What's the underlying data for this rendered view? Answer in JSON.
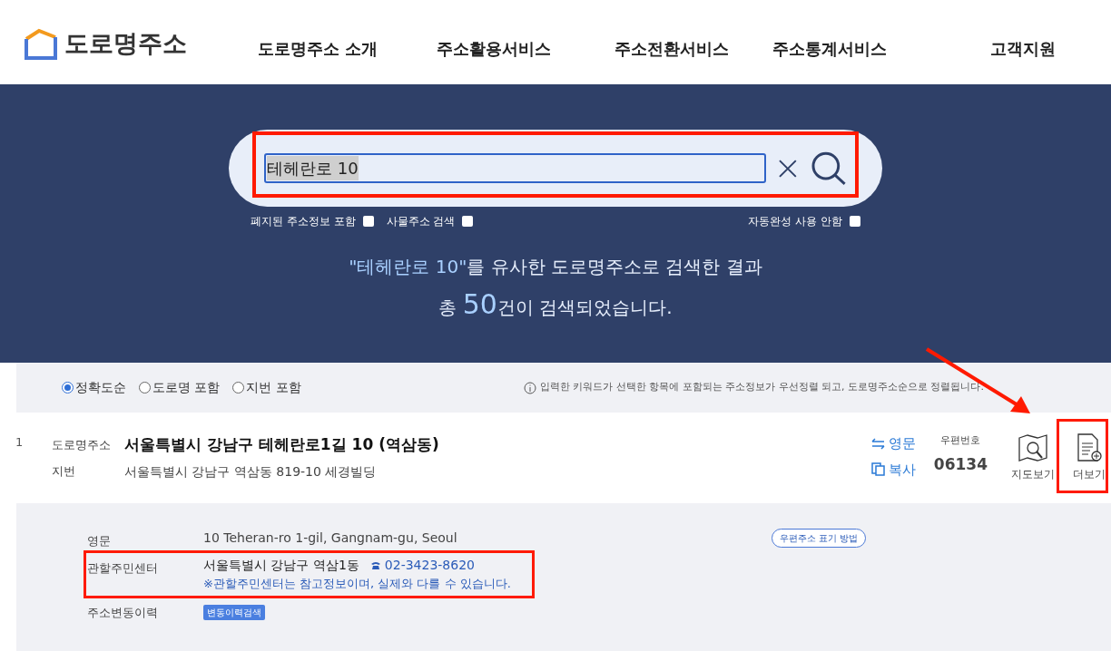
{
  "header": {
    "logo": "도로명주소",
    "nav": [
      "도로명주소 소개",
      "주소활용서비스",
      "주소전환서비스",
      "주소통계서비스",
      "고객지원"
    ]
  },
  "search": {
    "value": "테헤란로 10",
    "options": [
      {
        "label": "폐지된 주소정보 포함",
        "checked": false
      },
      {
        "label": "사물주소 검색",
        "checked": false
      },
      {
        "label": "자동완성 사용 안함",
        "checked": false
      }
    ]
  },
  "summary": {
    "line1_quote": "\"테헤란로 10\"",
    "line1_rest": "를 유사한 도로명주소로 검색한 결과",
    "line2_pre": "총",
    "count": "50",
    "line2_post": "건이 검색되었습니다."
  },
  "sort": [
    {
      "label": "정확도순",
      "selected": true
    },
    {
      "label": "도로명 포함",
      "selected": false
    },
    {
      "label": "지번 포함",
      "selected": false
    }
  ],
  "sort_note": "입력한 키워드가 선택한 항목에 포함되는 주소정보가 우선정렬 되고, 도로명주소순으로 정렬됩니다.",
  "result": {
    "index": "1",
    "road_label": "도로명주소",
    "road_address": "서울특별시 강남구 테헤란로1길 10 (역삼동)",
    "jibun_label": "지번",
    "jibun_address": "서울특별시 강남구 역삼동 819-10 세경빌딩",
    "english_link": "영문",
    "copy_link": "복사",
    "postal_label": "우편번호",
    "postal_code": "06134",
    "map_button": "지도보기",
    "more_button": "더보기"
  },
  "details": {
    "rows": [
      {
        "label": "영문",
        "value": "10 Teheran-ro 1-gil, Gangnam-gu, Seoul"
      },
      {
        "label": "관할주민센터",
        "value": "서울특별시 강남구 역삼1동",
        "phone": "02-3423-8620",
        "note": "※관할주민센터는 참고정보이며, 실제와 다를 수 있습니다."
      },
      {
        "label": "주소변동이력",
        "button": "변동이력검색"
      }
    ],
    "postal_guide": "우편주소 표기 방법"
  }
}
